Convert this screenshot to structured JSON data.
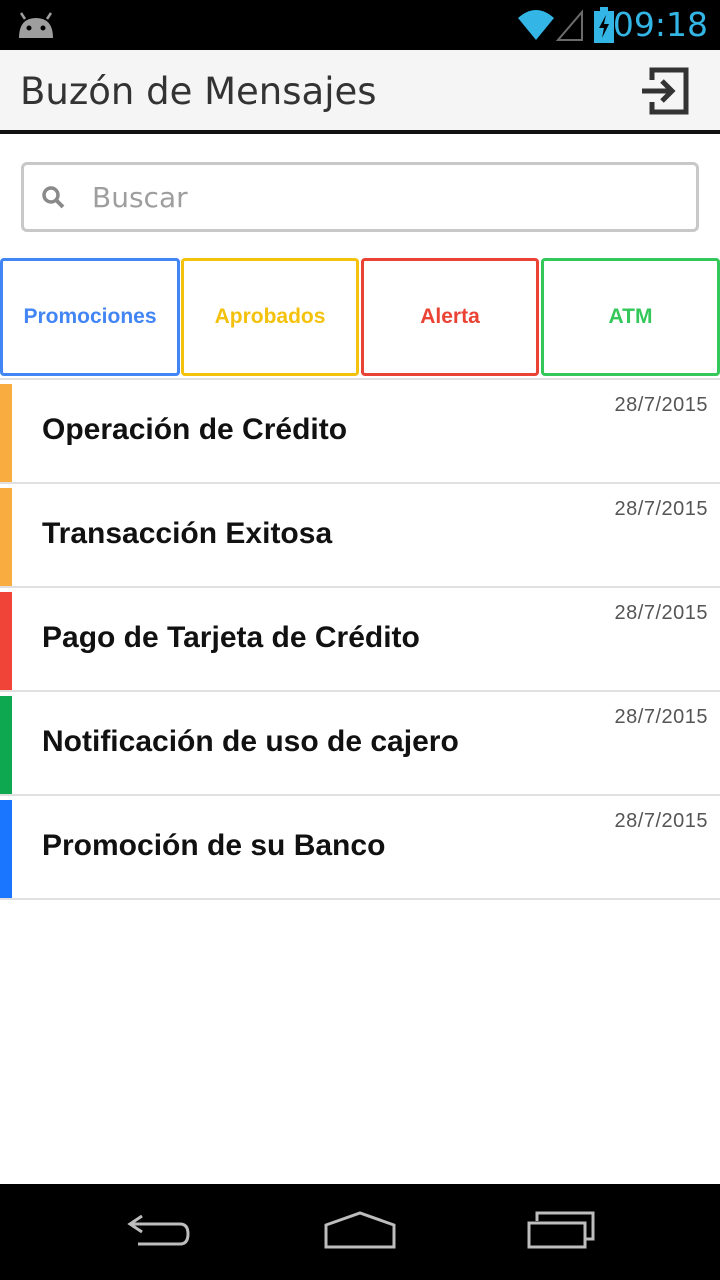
{
  "status_bar": {
    "time": "09:18",
    "icons": [
      "android-icon",
      "wifi-icon",
      "signal-icon",
      "battery-charging-icon"
    ],
    "accent_color": "#33b5e5"
  },
  "app_bar": {
    "title": "Buzón de Mensajes",
    "exit_icon": "exit-icon"
  },
  "search": {
    "placeholder": "Buscar",
    "value": "",
    "icon": "search-icon"
  },
  "tabs": [
    {
      "label": "Promociones",
      "color": "#4285f4"
    },
    {
      "label": "Aprobados",
      "color": "#f4c20d"
    },
    {
      "label": "Alerta",
      "color": "#ea4335"
    },
    {
      "label": "ATM",
      "color": "#34c759"
    }
  ],
  "messages": [
    {
      "title": "Operación de Crédito",
      "date": "28/7/2015",
      "color": "#f9ac3f"
    },
    {
      "title": "Transacción Exitosa",
      "date": "28/7/2015",
      "color": "#f9ac3f"
    },
    {
      "title": "Pago de Tarjeta de Crédito",
      "date": "28/7/2015",
      "color": "#f04438"
    },
    {
      "title": "Notificación de uso de cajero",
      "date": "28/7/2015",
      "color": "#0da84f"
    },
    {
      "title": "Promoción de su Banco",
      "date": "28/7/2015",
      "color": "#1a75ff"
    }
  ],
  "nav_bar": {
    "icons": [
      "back-icon",
      "home-icon",
      "recents-icon"
    ]
  }
}
